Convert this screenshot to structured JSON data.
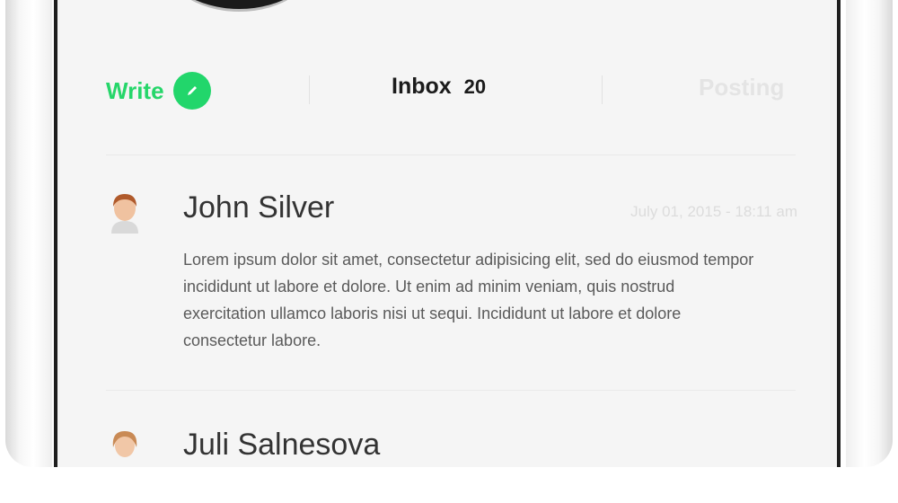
{
  "tabs": {
    "write_label": "Write",
    "inbox_label": "Inbox",
    "inbox_count": "20",
    "posting_label": "Posting"
  },
  "messages": [
    {
      "sender": "John Silver",
      "timestamp": "July 01, 2015 - 18:11 am",
      "body": "Lorem ipsum dolor sit amet, consectetur adipisicing elit, sed do eiusmod tempor incididunt ut labore et dolore. Ut enim ad minim veniam, quis nostrud exercitation ullamco laboris nisi ut sequi. Incididunt ut labore et dolore consectetur labore."
    },
    {
      "sender": "Juli Salnesova",
      "timestamp": ""
    }
  ],
  "colors": {
    "accent": "#22d66b",
    "primary_text": "#1b1b1b",
    "muted_text": "#dcdcdc"
  },
  "icons": {
    "write": "pencil-icon"
  }
}
